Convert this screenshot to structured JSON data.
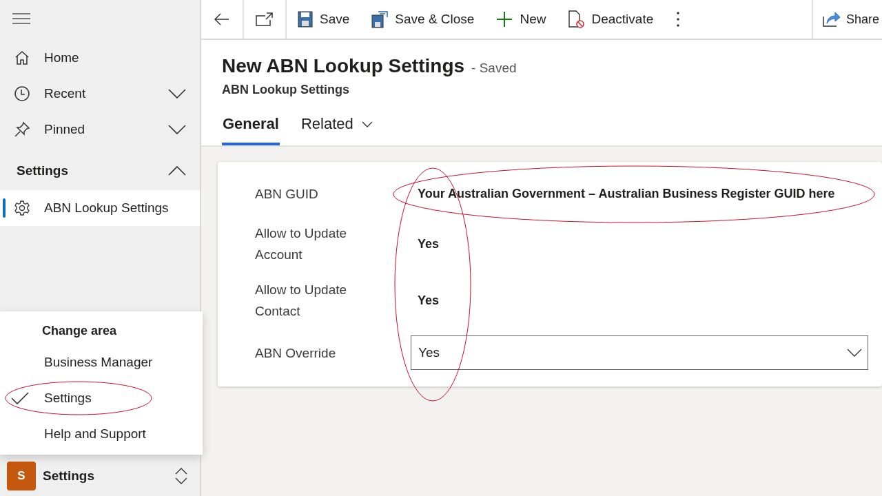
{
  "sidebar": {
    "items": [
      {
        "label": "Home",
        "expandable": false
      },
      {
        "label": "Recent",
        "expandable": true
      },
      {
        "label": "Pinned",
        "expandable": true
      }
    ],
    "group": {
      "label": "Settings",
      "expanded": true,
      "items": [
        {
          "label": "ABN Lookup Settings",
          "selected": true
        }
      ]
    },
    "area_menu": {
      "title": "Change area",
      "items": [
        {
          "label": "Business Manager",
          "selected": false,
          "annotated": false
        },
        {
          "label": "Settings",
          "selected": true,
          "annotated": true
        },
        {
          "label": "Help and Support",
          "selected": false,
          "annotated": false
        }
      ]
    },
    "area_switcher": {
      "initial": "S",
      "label": "Settings"
    }
  },
  "toolbar": {
    "buttons": [
      {
        "kind": "save",
        "label": "Save"
      },
      {
        "kind": "save-close",
        "label": "Save & Close"
      },
      {
        "kind": "new",
        "label": "New"
      },
      {
        "kind": "deactivate",
        "label": "Deactivate"
      }
    ],
    "share": {
      "label": "Share"
    }
  },
  "record": {
    "title": "New ABN Lookup Settings",
    "status": "- Saved",
    "entity": "ABN Lookup Settings"
  },
  "tabs": [
    {
      "label": "General",
      "selected": true,
      "dropdown": false
    },
    {
      "label": "Related",
      "selected": false,
      "dropdown": true
    }
  ],
  "form": {
    "values_annotated": true,
    "fields": [
      {
        "kind": "text",
        "label": "ABN GUID",
        "value": "Your Australian Government – Australian Business Register GUID here",
        "annotated": true
      },
      {
        "kind": "text",
        "label": "Allow to Update Account",
        "value": "Yes",
        "annotated": false
      },
      {
        "kind": "text",
        "label": "Allow to Update Contact",
        "value": "Yes",
        "annotated": false
      },
      {
        "kind": "select",
        "label": "ABN Override",
        "value": "Yes",
        "annotated": false
      }
    ]
  }
}
